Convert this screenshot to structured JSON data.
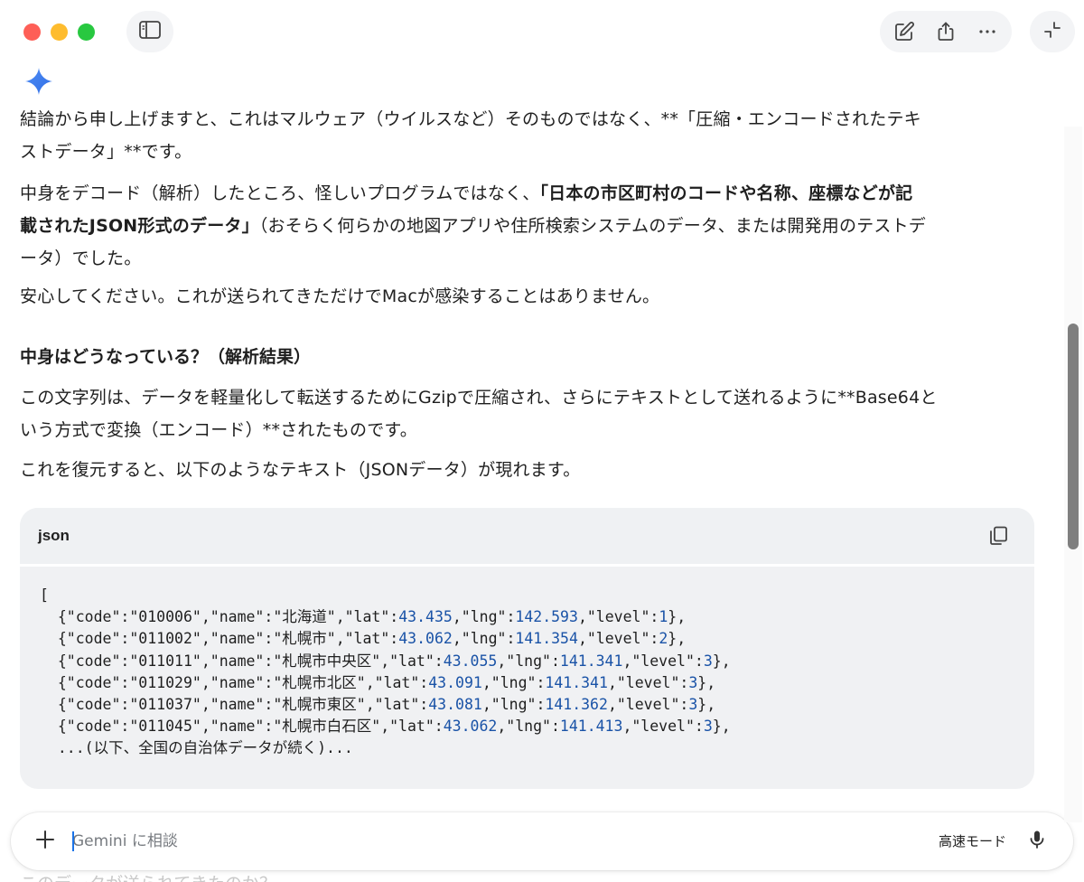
{
  "window": {
    "traffic_colors": [
      "#fe5f57",
      "#febc2e",
      "#28c840"
    ]
  },
  "toolbar": {
    "sidebar_icon": "sidebar-toggle-icon",
    "edit_icon": "edit-icon",
    "share_icon": "share-icon",
    "more_icon": "more-icon",
    "collapse_icon": "collapse-icon"
  },
  "response": {
    "paragraphs": [
      {
        "line1": "結論から申し上げますと、これはマルウェア（ウイルスなど）そのものではなく、**「圧縮・エンコードされたテキ",
        "line2": "ストデータ」**です。"
      },
      {
        "line1_a": "中身をデコード（解析）したところ、怪しいプログラムではなく、",
        "line1_b": "「日本の市区町村のコードや名称、座標などが記",
        "line2_b": "載されたJSON形式のデータ」",
        "line2_c": "（おそらく何らかの地図アプリや住所検索システムのデータ、または開発用のテストデ",
        "line3": "ータ）でした。"
      },
      {
        "line1": "安心してください。これが送られてきただけでMacが感染することはありません。"
      }
    ],
    "heading": "中身はどうなっている？（解析結果）",
    "para4": {
      "line1": "この文字列は、データを軽量化して転送するためにGzipで圧縮され、さらにテキストとして送れるように**Base64と",
      "line2": "いう方式で変換（エンコード）**されたものです。"
    },
    "para5": "これを復元すると、以下のようなテキスト（JSONデータ）が現れます。"
  },
  "code": {
    "lang": "json",
    "open": "[",
    "rows": [
      {
        "code": "010006",
        "name": "北海道",
        "lat": "43.435",
        "lng": "142.593",
        "level": "1"
      },
      {
        "code": "011002",
        "name": "札幌市",
        "lat": "43.062",
        "lng": "141.354",
        "level": "2"
      },
      {
        "code": "011011",
        "name": "札幌市中央区",
        "lat": "43.055",
        "lng": "141.341",
        "level": "3"
      },
      {
        "code": "011029",
        "name": "札幌市北区",
        "lat": "43.091",
        "lng": "141.341",
        "level": "3"
      },
      {
        "code": "011037",
        "name": "札幌市東区",
        "lat": "43.081",
        "lng": "141.362",
        "level": "3"
      },
      {
        "code": "011045",
        "name": "札幌市白石区",
        "lat": "43.062",
        "lng": "141.413",
        "level": "3"
      }
    ],
    "ellipsis": "...(以下、全国の自治体データが続く)..."
  },
  "input": {
    "placeholder": "Gemini に相談",
    "mode_label": "高速モード"
  },
  "below_text": "このデータが送られてきたのか？"
}
